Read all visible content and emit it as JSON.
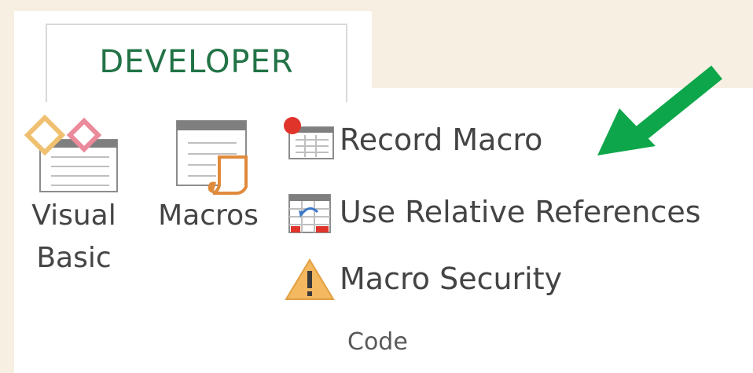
{
  "ribbon": {
    "tab_label": "DEVELOPER",
    "group_label": "Code",
    "visual_basic": {
      "line1": "Visual",
      "line2": "Basic",
      "icon": "visual-basic-icon"
    },
    "macros": {
      "label": "Macros",
      "icon": "macros-icon"
    },
    "record_macro": {
      "label": "Record Macro",
      "icon": "record-macro-icon"
    },
    "relative_refs": {
      "label": "Use Relative References",
      "icon": "relative-references-icon"
    },
    "macro_security": {
      "label": "Macro Security",
      "icon": "warning-icon"
    }
  },
  "annotation": {
    "arrow_color": "#0ea64a",
    "arrow_icon": "pointer-arrow-icon"
  },
  "colors": {
    "accent": "#217346",
    "background": "#f6efe2"
  }
}
